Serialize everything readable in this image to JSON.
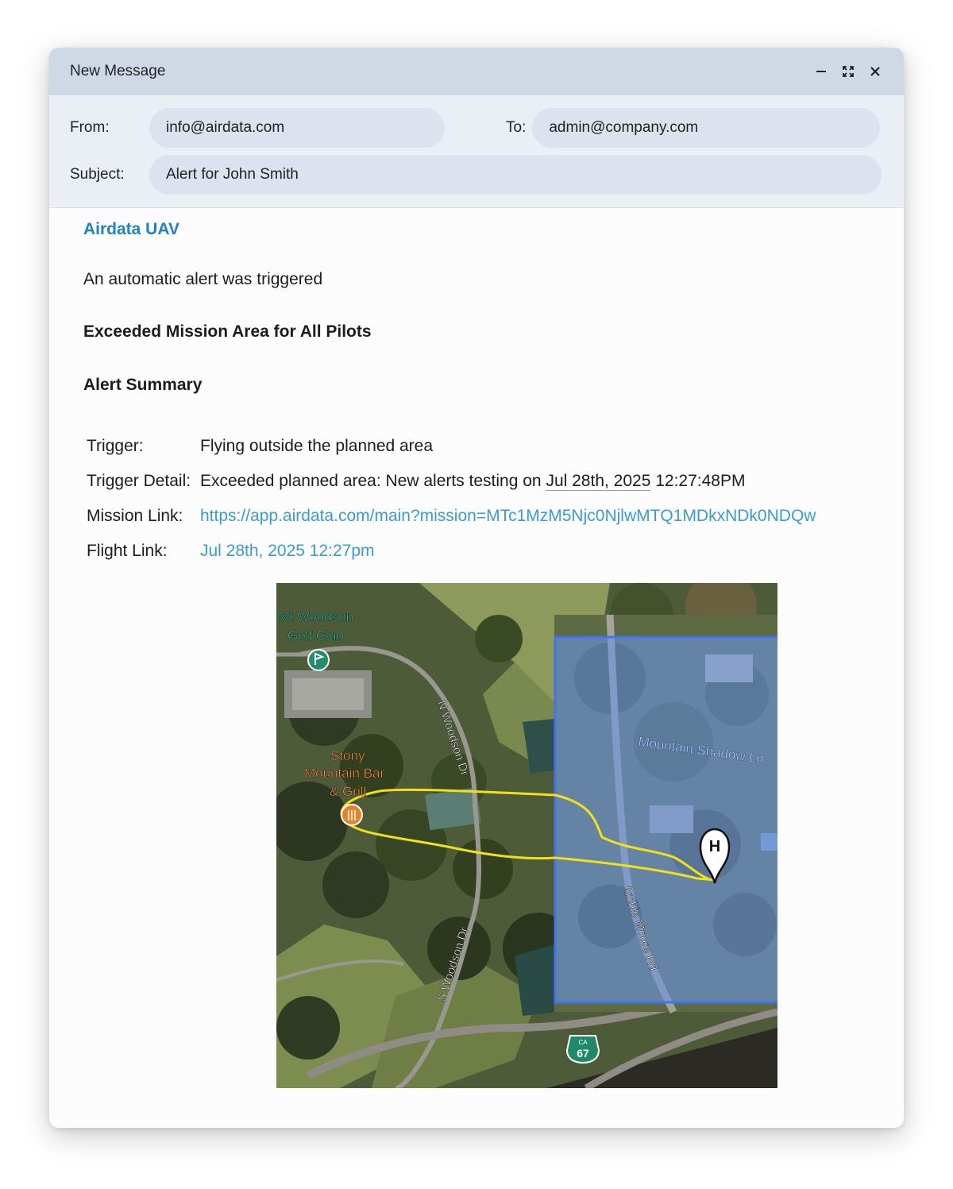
{
  "window": {
    "title": "New Message",
    "controls": [
      "minimize-icon",
      "fullscreen-icon",
      "close-icon"
    ]
  },
  "header": {
    "from_label": "From:",
    "from_value": "info@airdata.com",
    "to_label": "To:",
    "to_value": "admin@company.com",
    "subject_label": "Subject:",
    "subject_value": "Alert for John Smith"
  },
  "email": {
    "brand": "Airdata UAV",
    "intro": "An automatic alert was triggered",
    "alert_name": "Exceeded Mission Area for All Pilots",
    "summary_heading": "Alert Summary",
    "details": {
      "trigger_label": "Trigger:",
      "trigger_value": "Flying outside the planned area",
      "detail_label": "Trigger Detail:",
      "detail_prefix": "Exceeded planned area: New alerts testing on ",
      "detail_date": "Jul 28th, 2025",
      "detail_time": " 12:27:48PM",
      "mission_label": "Mission Link:",
      "mission_url": "https://app.airdata.com/main?mission=MTc1MzM5Njc0NjlwMTQ1MDkxNDk0NDQw",
      "flight_label": "Flight Link:",
      "flight_link": "Jul 28th, 2025 12:27pm"
    }
  },
  "map": {
    "poi_golf": "Mt Woodson Golf Club",
    "poi_golf_line1": "Mt Woodson",
    "poi_golf_line2": "Golf Club",
    "poi_bar_line1": "Stony",
    "poi_bar_line2": "Mountain Bar",
    "poi_bar_line3": "& Grill",
    "road_n_woodson": "N Woodson Dr",
    "road_s_woodson": "S Woodson Dr",
    "road_mountain_shadow": "Mountain Shadow Ln",
    "road_archie_moore": "Archie Moore Rd",
    "highway_state": "CA",
    "highway_number": "67",
    "home_marker": "H",
    "mission_area_color": "#4a7fe6",
    "flight_path_color": "#f5e21a"
  }
}
